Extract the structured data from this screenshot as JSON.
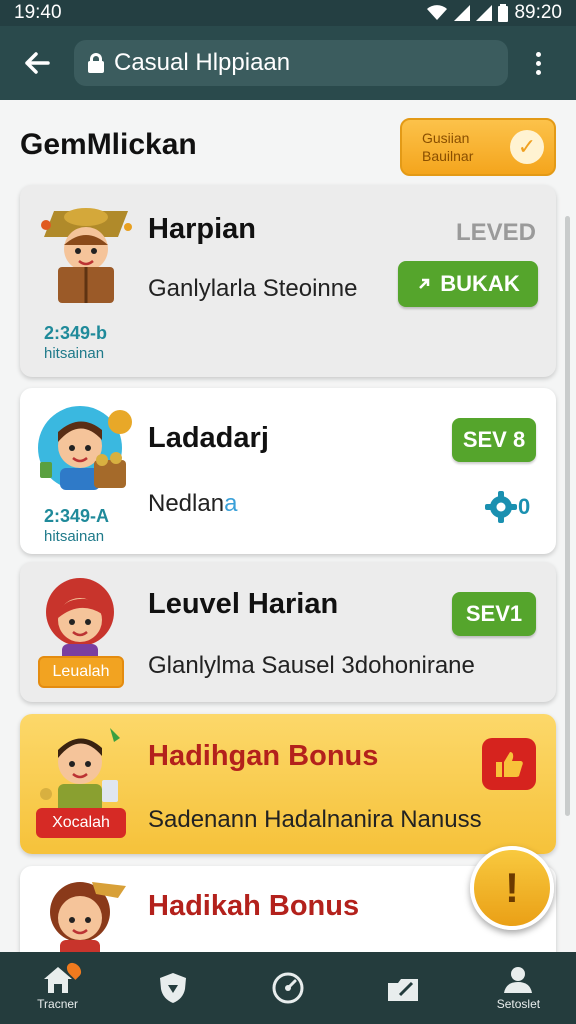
{
  "status_bar": {
    "time_left": "19:40",
    "time_right": "89:20"
  },
  "app_bar": {
    "url": "Casual Hlppiaan"
  },
  "page": {
    "title": "GemMlickan",
    "top_button": {
      "line1": "Gusiian",
      "line2": "Bauilnar"
    }
  },
  "cards": [
    {
      "title": "Harpian",
      "subtitle": "Ganlylarla Steoinne",
      "status": "LEVED",
      "button": "BUKAK",
      "code": "2:349-b",
      "name": "hitsainan"
    },
    {
      "title": "Ladadarj",
      "subtitle": "Nedlan",
      "subtitle_suffix": "a",
      "button": "SEV 8",
      "side_value": "0",
      "code": "2:349-A",
      "name": "hitsainan"
    },
    {
      "title": "Leuvel Harian",
      "subtitle": "Glanlylma Sausel 3dohonirane",
      "button": "SEV1",
      "tag": "Leualah"
    },
    {
      "title": "Hadihgan Bonus",
      "subtitle": "Sadenann Hadalnanira Nanuss",
      "tag": "Xocalah"
    },
    {
      "title": "Hadikah Bonus"
    }
  ],
  "fab": {
    "label": "!"
  },
  "bottom_nav": [
    {
      "label": "Tracner",
      "icon": "home-icon"
    },
    {
      "label": "",
      "icon": "shield-icon"
    },
    {
      "label": "",
      "icon": "gauge-icon"
    },
    {
      "label": "",
      "icon": "folder-icon"
    },
    {
      "label": "Setoslet",
      "icon": "person-icon"
    }
  ],
  "colors": {
    "header": "#2a4a4c",
    "status_bar": "#243f42",
    "green": "#55a52c",
    "gold": "#f6c23a",
    "red": "#d62a25",
    "teal": "#1f8a9a"
  }
}
